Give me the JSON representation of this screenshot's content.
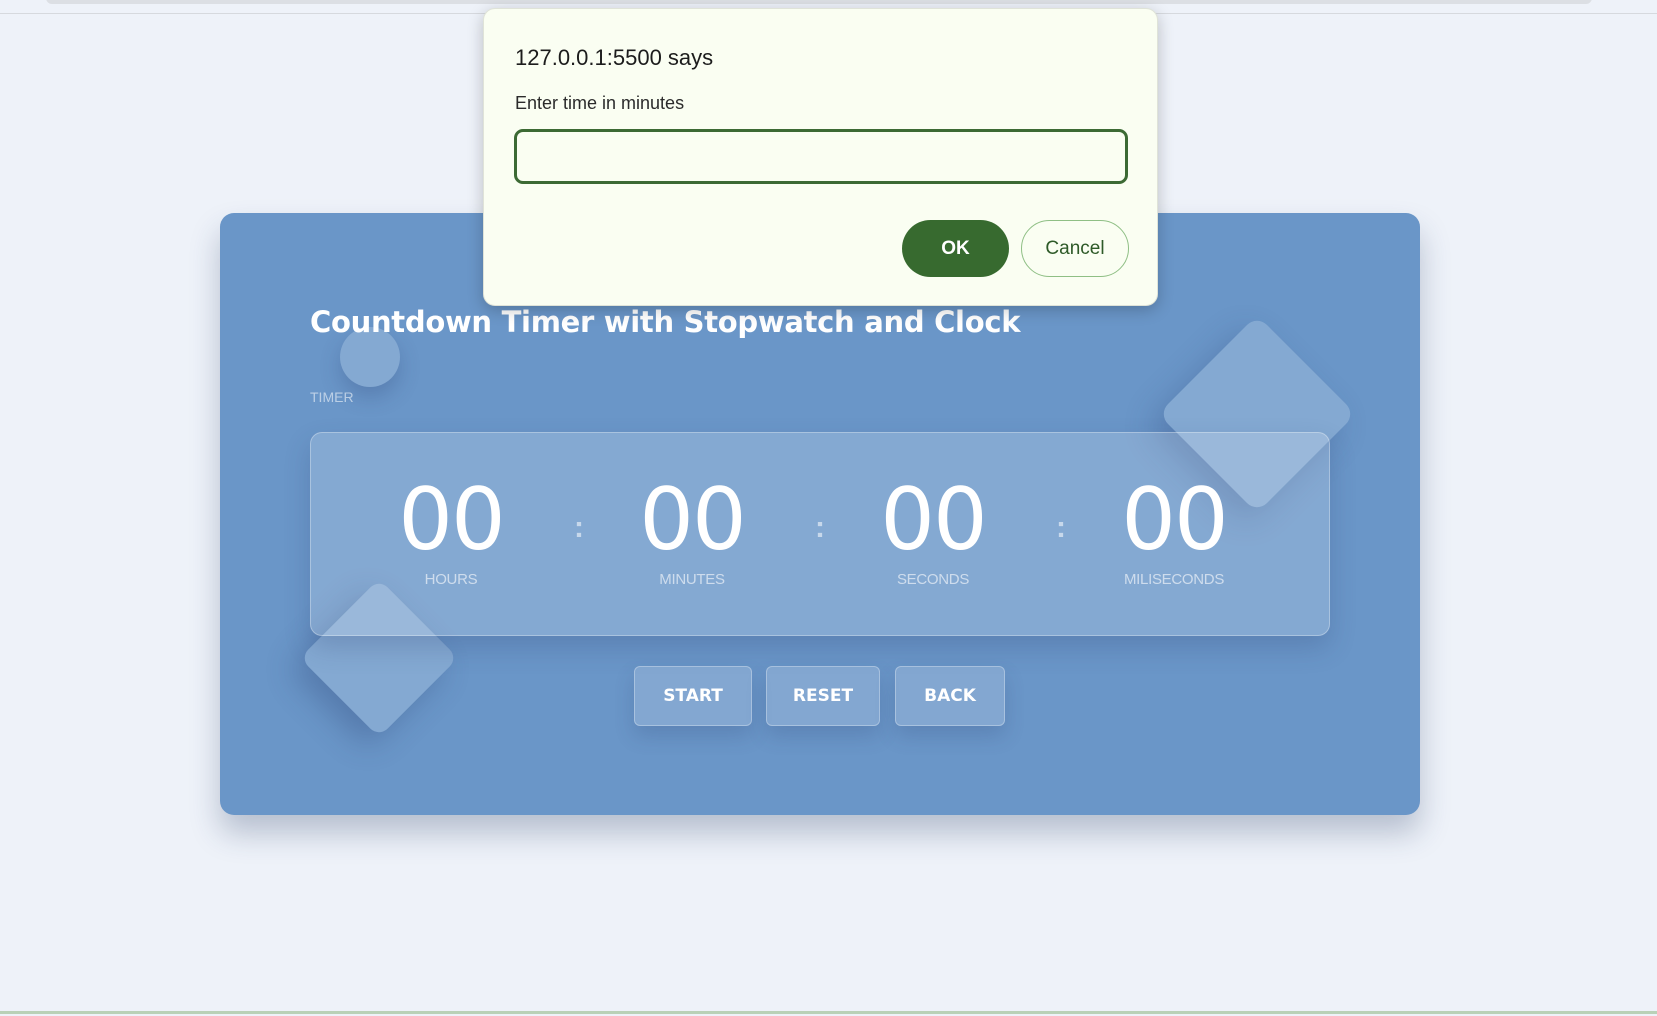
{
  "timer_card": {
    "title": "Countdown Timer with Stopwatch and Clock",
    "mode_label": "TIMER",
    "units": [
      {
        "value": "00",
        "label": "HOURS"
      },
      {
        "value": "00",
        "label": "MINUTES"
      },
      {
        "value": "00",
        "label": "SECONDS"
      },
      {
        "value": "00",
        "label": "MILISECONDS"
      }
    ],
    "separator": ":",
    "buttons": {
      "start": "START",
      "reset": "RESET",
      "back": "BACK"
    },
    "colors": {
      "card_background": "#6a96c8",
      "page_background": "#eef2f9"
    }
  },
  "prompt_dialog": {
    "title": "127.0.0.1:5500 says",
    "message": "Enter time in minutes",
    "input_value": "",
    "ok_label": "OK",
    "cancel_label": "Cancel",
    "colors": {
      "accent": "#376a2f",
      "background": "#fafef2"
    }
  }
}
